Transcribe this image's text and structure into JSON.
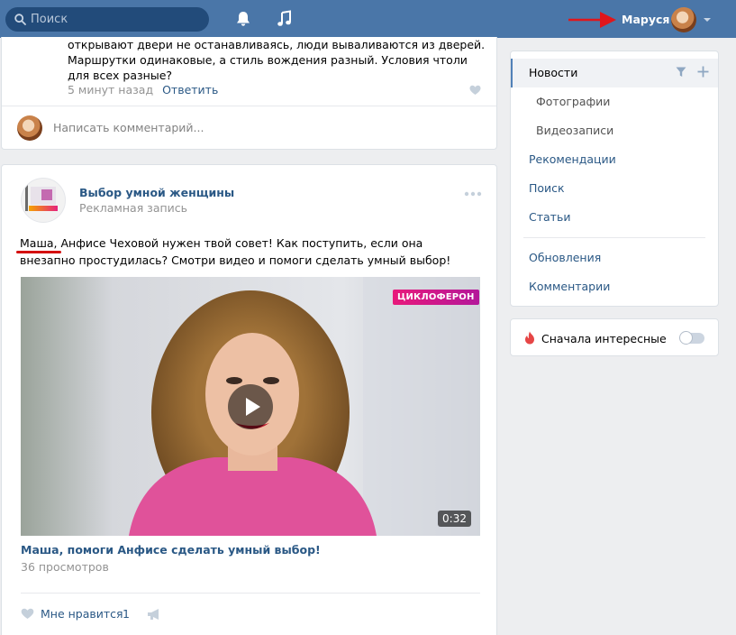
{
  "header": {
    "search_placeholder": "Поиск",
    "username": "Маруся",
    "accent": "#4a76a8"
  },
  "comment": {
    "text": "открывают двери не останавливаясь, люди вываливаются из дверей. Маршрутки одинаковые, а стиль вождения разный. Условия чтоли для всех разные?",
    "time": "5 минут назад",
    "reply_label": "Ответить",
    "write_placeholder": "Написать комментарий..."
  },
  "post": {
    "author": "Выбор умной женщины",
    "subtitle": "Рекламная запись",
    "text": "Маша, Анфисе Чеховой нужен твой совет! Как поступить, если она внезапно простудилась? Смотри видео и помоги сделать умный выбор!",
    "video": {
      "brand": "ЦИКЛОФЕРОН",
      "duration": "0:32",
      "title": "Маша, помоги Анфисе сделать умный выбор!",
      "views": "36 просмотров"
    },
    "like_label": "Мне нравится",
    "like_count": "1"
  },
  "sidebar": {
    "items": [
      {
        "label": "Новости"
      },
      {
        "label": "Фотографии"
      },
      {
        "label": "Видеозаписи"
      },
      {
        "label": "Рекомендации"
      },
      {
        "label": "Поиск"
      },
      {
        "label": "Статьи"
      },
      {
        "label": "Обновления"
      },
      {
        "label": "Комментарии"
      }
    ],
    "interesting_label": "Сначала интересные"
  }
}
